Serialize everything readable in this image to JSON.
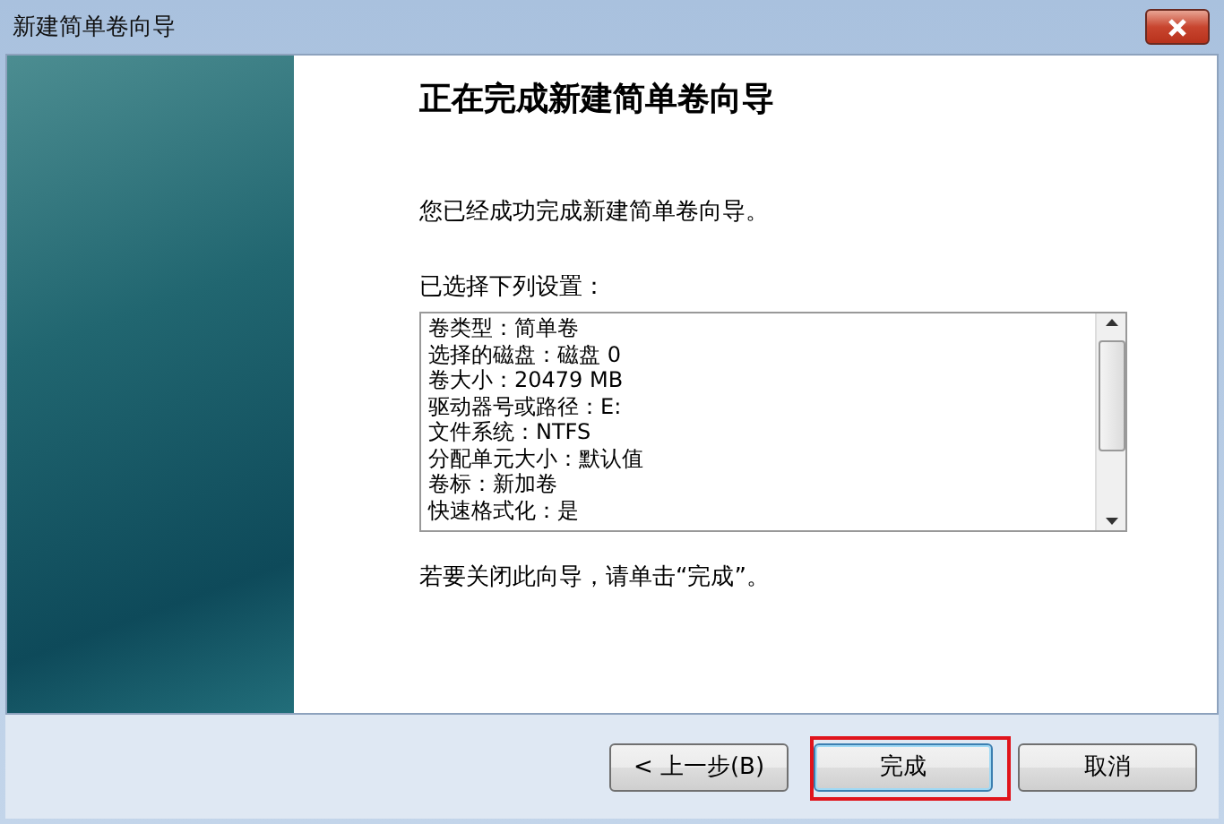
{
  "window": {
    "title": "新建简单卷向导"
  },
  "heading": "正在完成新建简单卷向导",
  "message": "您已经成功完成新建简单卷向导。",
  "settings_label": "已选择下列设置：",
  "settings": [
    "卷类型：简单卷",
    "选择的磁盘：磁盘 0",
    "卷大小：20479 MB",
    "驱动器号或路径：E:",
    "文件系统：NTFS",
    "分配单元大小：默认值",
    "卷标：新加卷",
    "快速格式化：是"
  ],
  "hint": "若要关闭此向导，请单击“完成”。",
  "buttons": [
    {
      "label": "< 上一步(B)",
      "focused": false,
      "highlighted": false
    },
    {
      "label": "完成",
      "focused": true,
      "highlighted": true
    },
    {
      "label": "取消",
      "focused": false,
      "highlighted": false
    }
  ]
}
